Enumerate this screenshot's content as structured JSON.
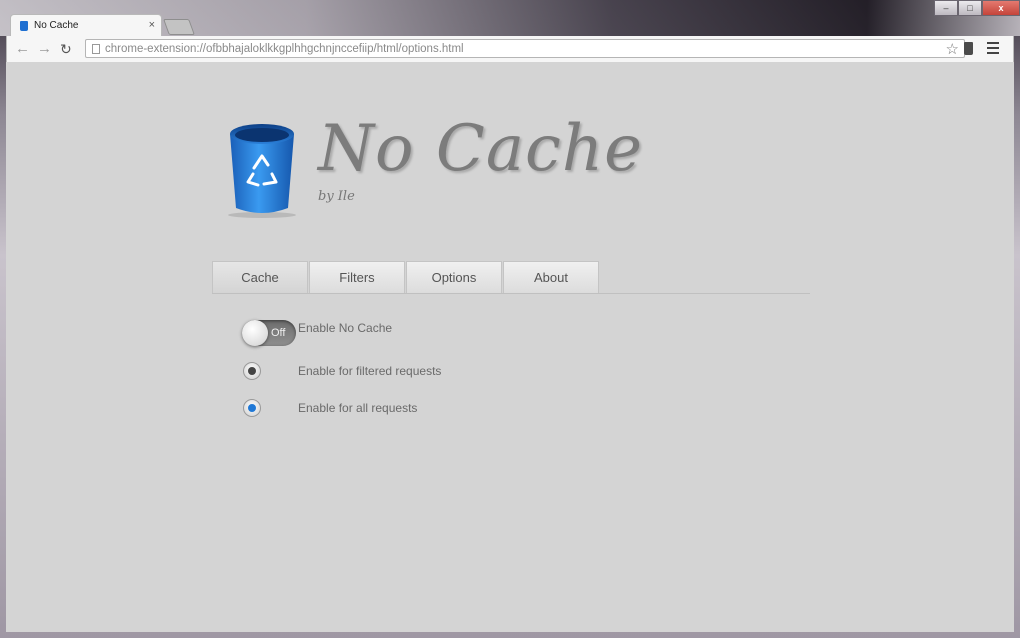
{
  "browser": {
    "tab_title": "No Cache",
    "close_glyph": "×",
    "url": "chrome-extension://ofbbhajaloklkkgplhhgchnjnccefiip/html/options.html",
    "window_controls": {
      "minimize": "–",
      "maximize": "□",
      "close": "x"
    }
  },
  "header": {
    "title": "No Cache",
    "byline": "by Ile"
  },
  "tabs": [
    {
      "label": "Cache"
    },
    {
      "label": "Filters"
    },
    {
      "label": "Options"
    },
    {
      "label": "About"
    }
  ],
  "settings": {
    "toggle_state": "Off",
    "enable_label": "Enable No Cache",
    "filtered_label": "Enable for filtered requests",
    "all_label": "Enable for all requests"
  },
  "colors": {
    "accent": "#1f78d6",
    "radio_dark": "#444444"
  }
}
